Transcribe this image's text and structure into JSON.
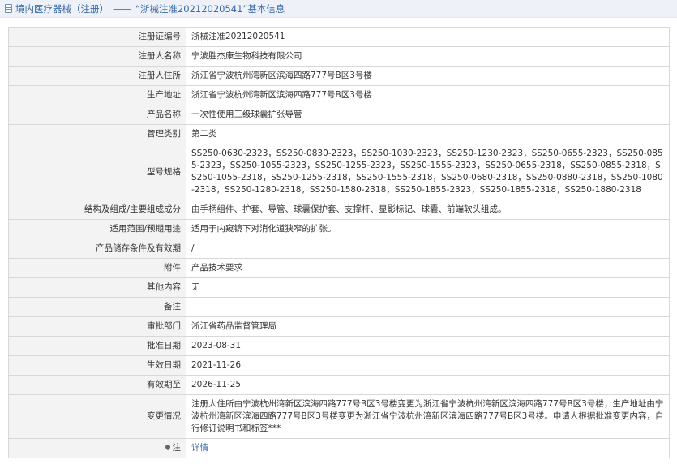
{
  "header": {
    "breadcrumb_root": "境内医疗器械（注册）",
    "separator": "——",
    "title": "“浙械注准20212020541”基本信息",
    "icon": "document-icon"
  },
  "rows": [
    {
      "key": "注册证编号",
      "value": "浙械注准20212020541"
    },
    {
      "key": "注册人名称",
      "value": "宁波胜杰康生物科技有限公司"
    },
    {
      "key": "注册人住所",
      "value": "浙江省宁波杭州湾新区滨海四路777号B区3号楼"
    },
    {
      "key": "生产地址",
      "value": "浙江省宁波杭州湾新区滨海四路777号B区3号楼"
    },
    {
      "key": "产品名称",
      "value": "一次性使用三级球囊扩张导管"
    },
    {
      "key": "管理类别",
      "value": "第二类"
    },
    {
      "key": "型号规格",
      "value": "SS250-0630-2323，SS250-0830-2323，SS250-1030-2323，SS250-1230-2323，SS250-0655-2323，SS250-0855-2323，SS250-1055-2323，SS250-1255-2323，SS250-1555-2323，SS250-0655-2318，SS250-0855-2318，SS250-1055-2318，SS250-1255-2318，SS250-1555-2318，SS250-0680-2318，SS250-0880-2318，SS250-1080-2318，SS250-1280-2318，SS250-1580-2318，SS250-1855-2323，SS250-1855-2318，SS250-1880-2318"
    },
    {
      "key": "结构及组成/主要组成成分",
      "value": "由手柄组件、护套、导管、球囊保护套、支撑杆、显影标记、球囊、前端软头组成。"
    },
    {
      "key": "适用范围/预期用途",
      "value": "适用于内窥镜下对消化道狭窄的扩张。"
    },
    {
      "key": "产品储存条件及有效期",
      "value": "/"
    },
    {
      "key": "附件",
      "value": "产品技术要求"
    },
    {
      "key": "其他内容",
      "value": "无"
    },
    {
      "key": "备注",
      "value": ""
    },
    {
      "key": "审批部门",
      "value": "浙江省药品监督管理局"
    },
    {
      "key": "批准日期",
      "value": "2023-08-31"
    },
    {
      "key": "生效日期",
      "value": "2021-11-26"
    },
    {
      "key": "有效期至",
      "value": "2026-11-25"
    },
    {
      "key": "变更情况",
      "value": "注册人住所由宁波杭州湾新区滨海四路777号B区3号楼变更为浙江省宁波杭州湾新区滨海四路777号B区3号楼；生产地址由宁波杭州湾新区滨海四路777号B区3号楼变更为浙江省宁波杭州湾新区滨海四路777号B区3号楼。申请人根据批准变更内容，自行修订说明书和标签***"
    }
  ],
  "note": {
    "key": "注",
    "icon": "pin-icon",
    "link_label": "详情"
  }
}
